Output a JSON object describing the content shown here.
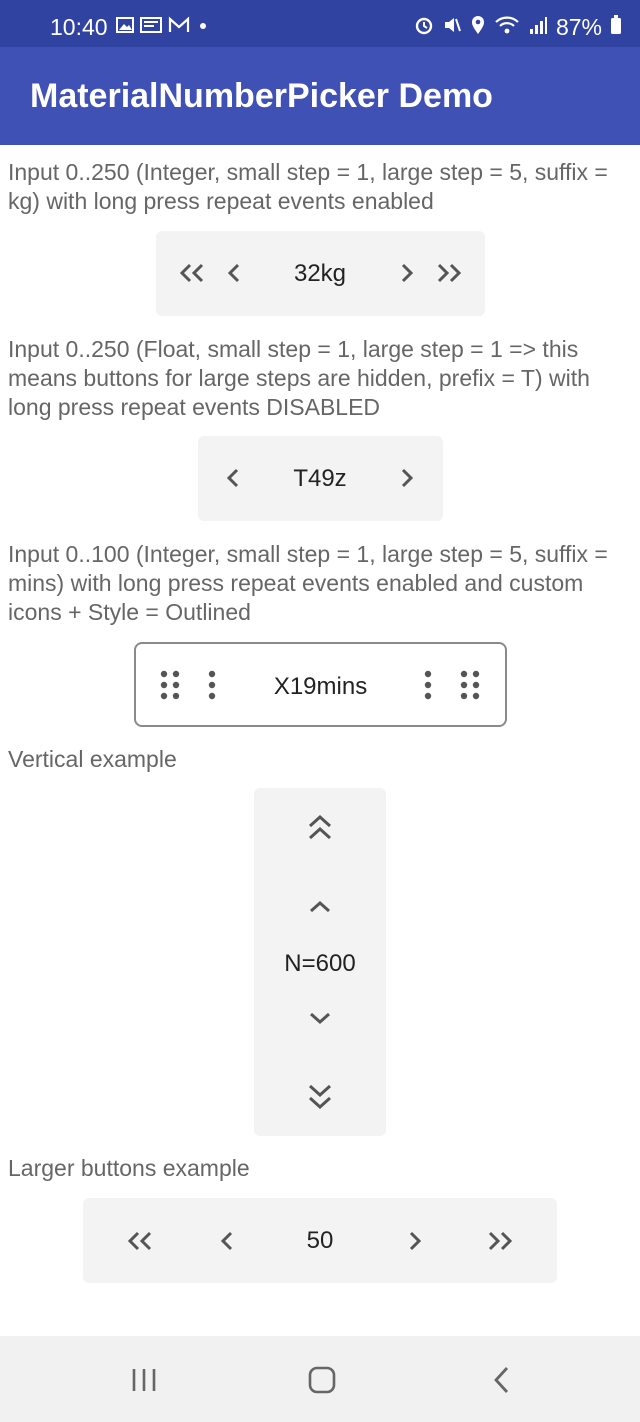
{
  "status_bar": {
    "time": "10:40",
    "battery": "87%",
    "icons_left": [
      "gallery-icon",
      "gmail-like-icon",
      "mail-icon",
      "dot-icon"
    ],
    "icons_right": [
      "alarm-icon",
      "mute-icon",
      "location-icon",
      "wifi-icon",
      "signal-icon",
      "battery-icon"
    ]
  },
  "app_bar": {
    "title": "MaterialNumberPicker Demo"
  },
  "sections": {
    "s1": {
      "label": "Input 0..250 (Integer, small step = 1, large step = 5, suffix = kg) with long press repeat events enabled",
      "value": "32kg"
    },
    "s2": {
      "label": "Input 0..250 (Float, small step = 1, large step = 1 => this means buttons for large steps are hidden, prefix = T) with long press repeat events DISABLED",
      "value": "T49z"
    },
    "s3": {
      "label": "Input 0..100 (Integer, small step = 1, large step = 5, suffix = mins) with long press repeat events enabled and custom icons + Style = Outlined",
      "value": "X19mins"
    },
    "s4": {
      "label": "Vertical example",
      "value": "N=600"
    },
    "s5": {
      "label": "Larger buttons example",
      "value": "50"
    }
  },
  "colors": {
    "status_bar": "#3143a0",
    "app_bar": "#3f51b5",
    "picker_bg": "#f3f3f3",
    "icon": "#555555"
  }
}
